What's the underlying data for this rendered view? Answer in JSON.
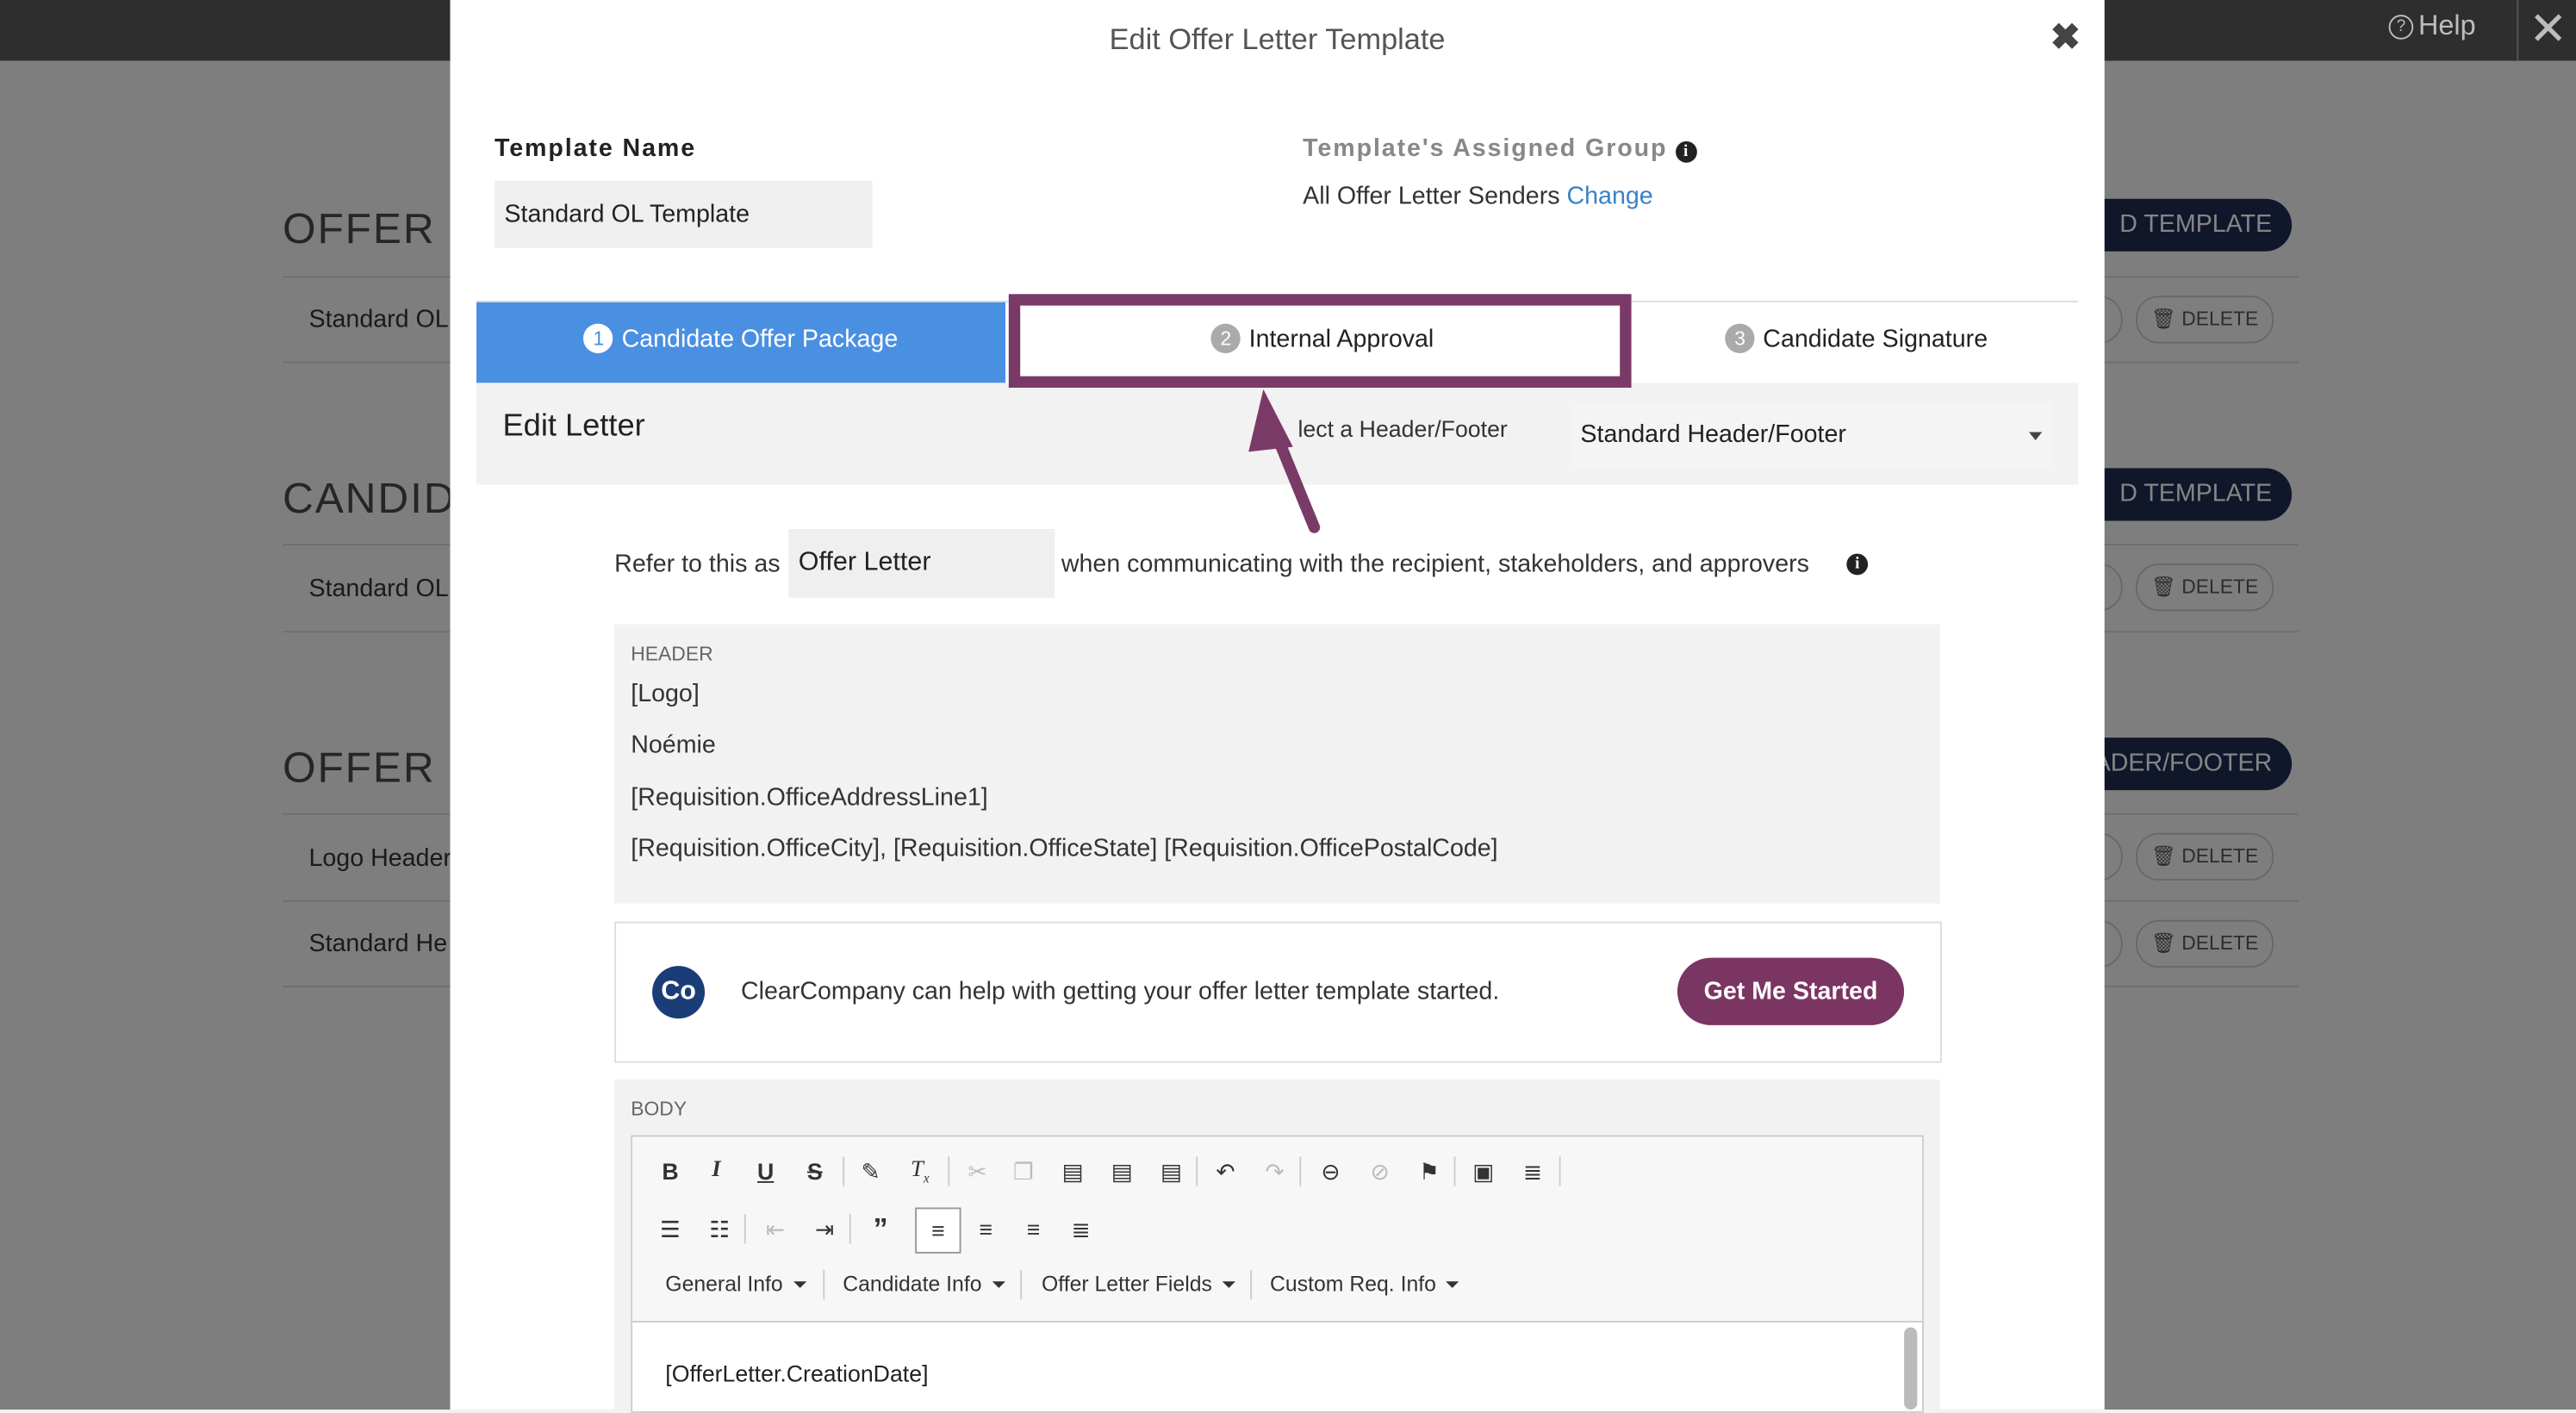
{
  "topbar": {
    "help_label": "Help",
    "close_glyph": "✕"
  },
  "background": {
    "sections": [
      {
        "title": "OFFER LE",
        "button": "D TEMPLATE",
        "rows": [
          "Standard OL"
        ]
      },
      {
        "title": "CANDIDA",
        "button": "D TEMPLATE",
        "rows": [
          "Standard OL"
        ]
      },
      {
        "title": "OFFER LE",
        "button": "ADER/FOOTER",
        "rows": [
          "Logo Header",
          "Standard He"
        ]
      }
    ],
    "delete_label": "DELETE"
  },
  "modal": {
    "title": "Edit Offer Letter Template",
    "close_glyph": "✖",
    "template_name_label": "Template Name",
    "template_name_value": "Standard OL Template",
    "assigned_group_label": "Template's Assigned Group",
    "assigned_group_value": "All Offer Letter Senders",
    "change_link": "Change",
    "tabs": [
      {
        "num": "1",
        "label": "Candidate Offer Package",
        "active": true
      },
      {
        "num": "2",
        "label": "Internal Approval",
        "active": false
      },
      {
        "num": "3",
        "label": "Candidate Signature",
        "active": false
      }
    ],
    "edit_letter_title": "Edit Letter",
    "header_footer_label": "lect a Header/Footer",
    "header_footer_value": "Standard Header/Footer",
    "refer_prefix": "Refer to this as",
    "refer_value": "Offer Letter",
    "refer_suffix": "when communicating with the recipient, stakeholders, and approvers",
    "header_label": "HEADER",
    "header_lines": [
      "[Logo]",
      "Noémie",
      "[Requisition.OfficeAddressLine1]",
      "[Requisition.OfficeCity], [Requisition.OfficeState] [Requisition.OfficePostalCode]"
    ],
    "cc_logo_text": "Co",
    "cc_message": "ClearCompany can help with getting your offer letter template started.",
    "cc_button": "Get Me Started",
    "body_label": "BODY",
    "dropdowns": [
      "General Info",
      "Candidate Info",
      "Offer Letter Fields",
      "Custom Req. Info"
    ],
    "body_first_line": "[OfferLetter.CreationDate]"
  },
  "colors": {
    "accent_tab": "#4a90e2",
    "highlight": "#7a3a67",
    "pill": "#1f2d52",
    "cta": "#7b3562"
  }
}
